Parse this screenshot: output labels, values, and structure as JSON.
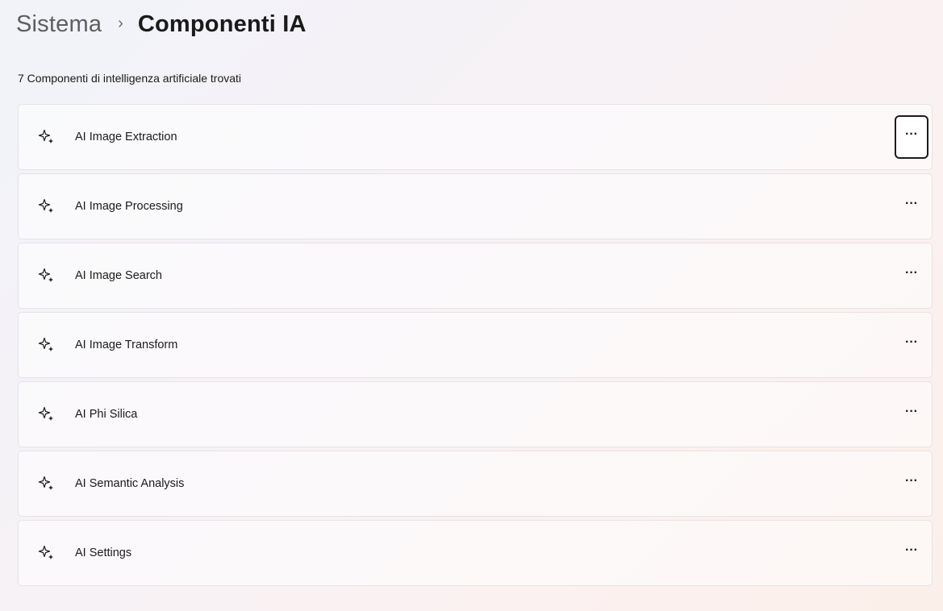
{
  "breadcrumb": {
    "parent": "Sistema",
    "separator": "›",
    "current": "Componenti IA"
  },
  "summary": {
    "count_text": "7 Componenti di intelligenza artificiale trovati"
  },
  "components": [
    {
      "label": "AI Image Extraction",
      "icon": "sparkle-icon",
      "more": "···",
      "focused": true
    },
    {
      "label": "AI Image Processing",
      "icon": "sparkle-icon",
      "more": "···",
      "focused": false
    },
    {
      "label": "AI Image Search",
      "icon": "sparkle-icon",
      "more": "···",
      "focused": false
    },
    {
      "label": "AI Image Transform",
      "icon": "sparkle-icon",
      "more": "···",
      "focused": false
    },
    {
      "label": "AI Phi Silica",
      "icon": "sparkle-icon",
      "more": "···",
      "focused": false
    },
    {
      "label": "AI Semantic Analysis",
      "icon": "sparkle-icon",
      "more": "···",
      "focused": false
    },
    {
      "label": "AI Settings",
      "icon": "sparkle-icon",
      "more": "···",
      "focused": false
    }
  ],
  "colors": {
    "text": "#1b1b1b",
    "breadcrumb_parent": "#5e5e5e",
    "card_border": "#e6e3e6",
    "focus_ring": "#1b1b1b"
  }
}
